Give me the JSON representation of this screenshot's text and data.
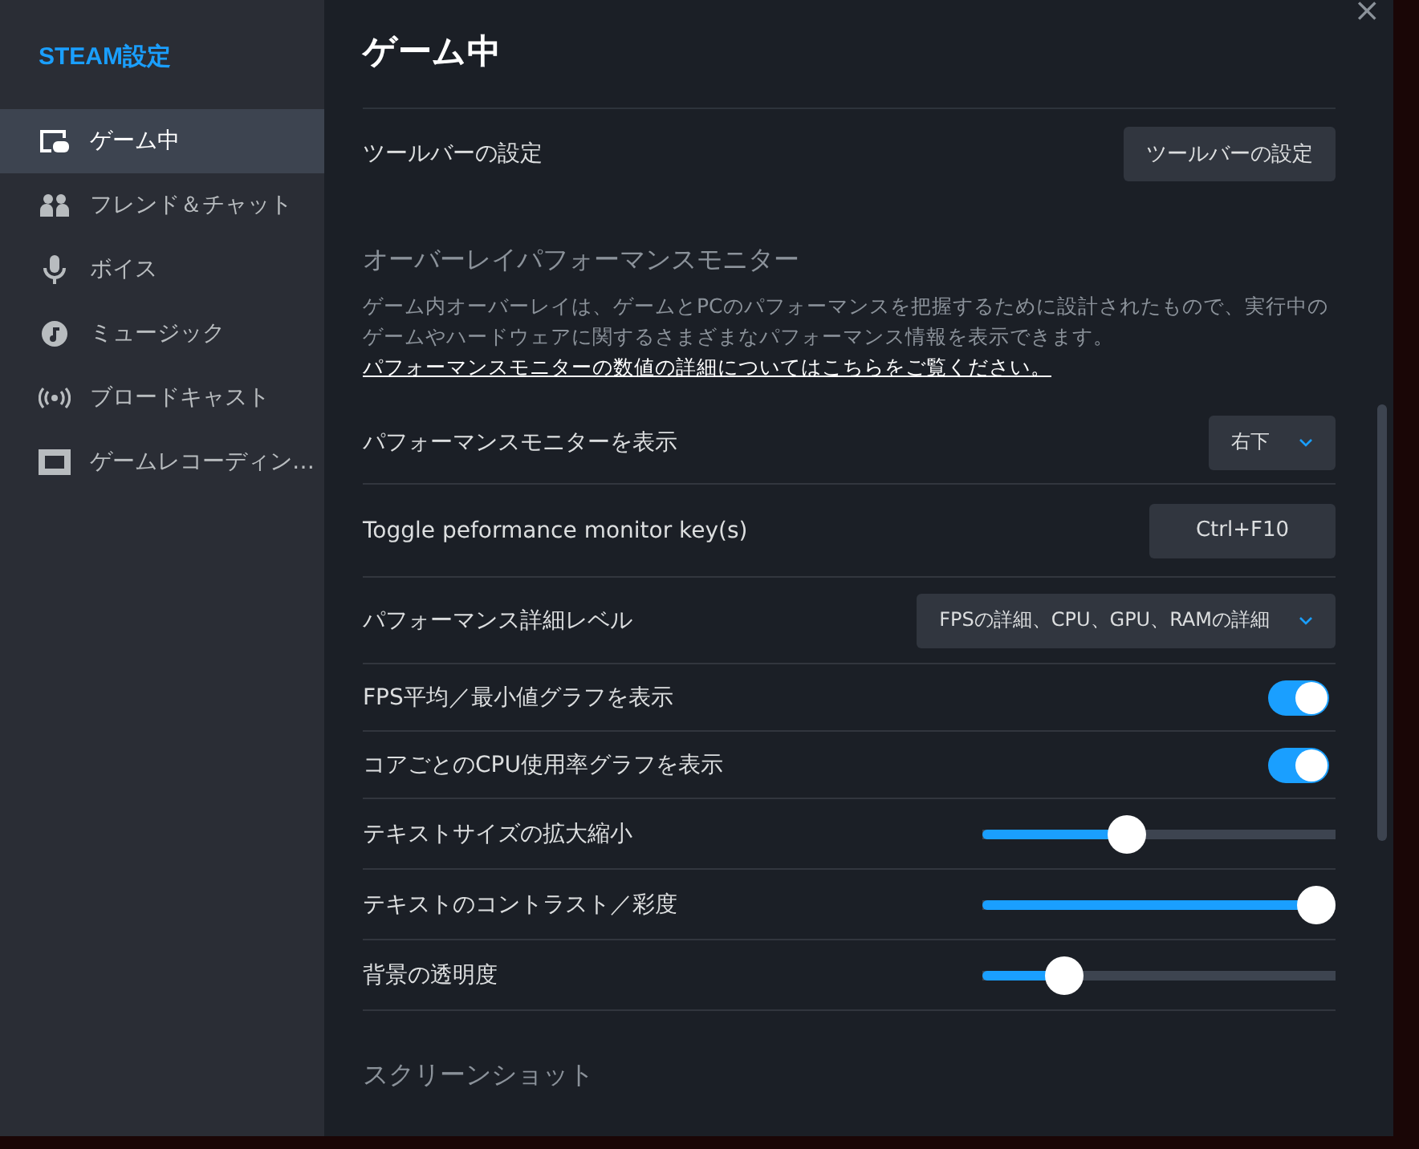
{
  "sidebar": {
    "title": "STEAM設定",
    "items": [
      {
        "label": "ゲーム中",
        "selected": true
      },
      {
        "label": "フレンド＆チャット",
        "selected": false
      },
      {
        "label": "ボイス",
        "selected": false
      },
      {
        "label": "ミュージック",
        "selected": false
      },
      {
        "label": "ブロードキャスト",
        "selected": false
      },
      {
        "label": "ゲームレコーディン…",
        "selected": false
      }
    ]
  },
  "close": "×",
  "page": {
    "title": "ゲーム中",
    "toolbar_row": {
      "label": "ツールバーの設定",
      "button": "ツールバーの設定"
    },
    "section": {
      "heading": "オーバーレイパフォーマンスモニター",
      "description": "ゲーム内オーバーレイは、ゲームとPCのパフォーマンスを把握するために設計されたもので、実行中のゲームやハードウェアに関するさまざまなパフォーマンス情報を表示できます。",
      "link": "パフォーマンスモニターの数値の詳細についてはこちらをご覧ください。"
    },
    "rows": [
      {
        "kind": "dropdown",
        "label": "パフォーマンスモニターを表示",
        "value": "右下"
      },
      {
        "kind": "key",
        "label": "Toggle peformance monitor key(s)",
        "value": "Ctrl+F10"
      },
      {
        "kind": "dropdown",
        "label": "パフォーマンス詳細レベル",
        "value": "FPSの詳細、CPU、GPU、RAMの詳細"
      },
      {
        "kind": "toggle",
        "label": "FPS平均／最小値グラフを表示",
        "on": true
      },
      {
        "kind": "toggle",
        "label": "コアごとのCPU使用率グラフを表示",
        "on": true
      },
      {
        "kind": "slider",
        "label": "テキストサイズの拡大縮小",
        "level": 0.4
      },
      {
        "kind": "slider",
        "label": "テキストのコントラスト／彩度",
        "level": 1.0
      },
      {
        "kind": "slider",
        "label": "背景の透明度",
        "level": 0.2
      }
    ],
    "next_heading": "スクリーンショット"
  }
}
